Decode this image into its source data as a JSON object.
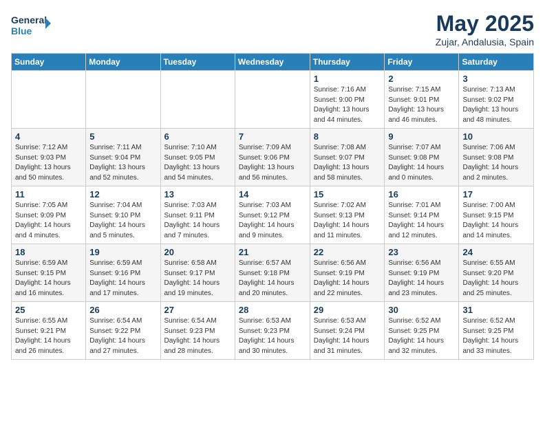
{
  "header": {
    "logo_line1": "General",
    "logo_line2": "Blue",
    "month_year": "May 2025",
    "location": "Zujar, Andalusia, Spain"
  },
  "days_of_week": [
    "Sunday",
    "Monday",
    "Tuesday",
    "Wednesday",
    "Thursday",
    "Friday",
    "Saturday"
  ],
  "weeks": [
    [
      {
        "num": "",
        "info": ""
      },
      {
        "num": "",
        "info": ""
      },
      {
        "num": "",
        "info": ""
      },
      {
        "num": "",
        "info": ""
      },
      {
        "num": "1",
        "info": "Sunrise: 7:16 AM\nSunset: 9:00 PM\nDaylight: 13 hours\nand 44 minutes."
      },
      {
        "num": "2",
        "info": "Sunrise: 7:15 AM\nSunset: 9:01 PM\nDaylight: 13 hours\nand 46 minutes."
      },
      {
        "num": "3",
        "info": "Sunrise: 7:13 AM\nSunset: 9:02 PM\nDaylight: 13 hours\nand 48 minutes."
      }
    ],
    [
      {
        "num": "4",
        "info": "Sunrise: 7:12 AM\nSunset: 9:03 PM\nDaylight: 13 hours\nand 50 minutes."
      },
      {
        "num": "5",
        "info": "Sunrise: 7:11 AM\nSunset: 9:04 PM\nDaylight: 13 hours\nand 52 minutes."
      },
      {
        "num": "6",
        "info": "Sunrise: 7:10 AM\nSunset: 9:05 PM\nDaylight: 13 hours\nand 54 minutes."
      },
      {
        "num": "7",
        "info": "Sunrise: 7:09 AM\nSunset: 9:06 PM\nDaylight: 13 hours\nand 56 minutes."
      },
      {
        "num": "8",
        "info": "Sunrise: 7:08 AM\nSunset: 9:07 PM\nDaylight: 13 hours\nand 58 minutes."
      },
      {
        "num": "9",
        "info": "Sunrise: 7:07 AM\nSunset: 9:08 PM\nDaylight: 14 hours\nand 0 minutes."
      },
      {
        "num": "10",
        "info": "Sunrise: 7:06 AM\nSunset: 9:08 PM\nDaylight: 14 hours\nand 2 minutes."
      }
    ],
    [
      {
        "num": "11",
        "info": "Sunrise: 7:05 AM\nSunset: 9:09 PM\nDaylight: 14 hours\nand 4 minutes."
      },
      {
        "num": "12",
        "info": "Sunrise: 7:04 AM\nSunset: 9:10 PM\nDaylight: 14 hours\nand 5 minutes."
      },
      {
        "num": "13",
        "info": "Sunrise: 7:03 AM\nSunset: 9:11 PM\nDaylight: 14 hours\nand 7 minutes."
      },
      {
        "num": "14",
        "info": "Sunrise: 7:03 AM\nSunset: 9:12 PM\nDaylight: 14 hours\nand 9 minutes."
      },
      {
        "num": "15",
        "info": "Sunrise: 7:02 AM\nSunset: 9:13 PM\nDaylight: 14 hours\nand 11 minutes."
      },
      {
        "num": "16",
        "info": "Sunrise: 7:01 AM\nSunset: 9:14 PM\nDaylight: 14 hours\nand 12 minutes."
      },
      {
        "num": "17",
        "info": "Sunrise: 7:00 AM\nSunset: 9:15 PM\nDaylight: 14 hours\nand 14 minutes."
      }
    ],
    [
      {
        "num": "18",
        "info": "Sunrise: 6:59 AM\nSunset: 9:15 PM\nDaylight: 14 hours\nand 16 minutes."
      },
      {
        "num": "19",
        "info": "Sunrise: 6:59 AM\nSunset: 9:16 PM\nDaylight: 14 hours\nand 17 minutes."
      },
      {
        "num": "20",
        "info": "Sunrise: 6:58 AM\nSunset: 9:17 PM\nDaylight: 14 hours\nand 19 minutes."
      },
      {
        "num": "21",
        "info": "Sunrise: 6:57 AM\nSunset: 9:18 PM\nDaylight: 14 hours\nand 20 minutes."
      },
      {
        "num": "22",
        "info": "Sunrise: 6:56 AM\nSunset: 9:19 PM\nDaylight: 14 hours\nand 22 minutes."
      },
      {
        "num": "23",
        "info": "Sunrise: 6:56 AM\nSunset: 9:19 PM\nDaylight: 14 hours\nand 23 minutes."
      },
      {
        "num": "24",
        "info": "Sunrise: 6:55 AM\nSunset: 9:20 PM\nDaylight: 14 hours\nand 25 minutes."
      }
    ],
    [
      {
        "num": "25",
        "info": "Sunrise: 6:55 AM\nSunset: 9:21 PM\nDaylight: 14 hours\nand 26 minutes."
      },
      {
        "num": "26",
        "info": "Sunrise: 6:54 AM\nSunset: 9:22 PM\nDaylight: 14 hours\nand 27 minutes."
      },
      {
        "num": "27",
        "info": "Sunrise: 6:54 AM\nSunset: 9:23 PM\nDaylight: 14 hours\nand 28 minutes."
      },
      {
        "num": "28",
        "info": "Sunrise: 6:53 AM\nSunset: 9:23 PM\nDaylight: 14 hours\nand 30 minutes."
      },
      {
        "num": "29",
        "info": "Sunrise: 6:53 AM\nSunset: 9:24 PM\nDaylight: 14 hours\nand 31 minutes."
      },
      {
        "num": "30",
        "info": "Sunrise: 6:52 AM\nSunset: 9:25 PM\nDaylight: 14 hours\nand 32 minutes."
      },
      {
        "num": "31",
        "info": "Sunrise: 6:52 AM\nSunset: 9:25 PM\nDaylight: 14 hours\nand 33 minutes."
      }
    ]
  ]
}
